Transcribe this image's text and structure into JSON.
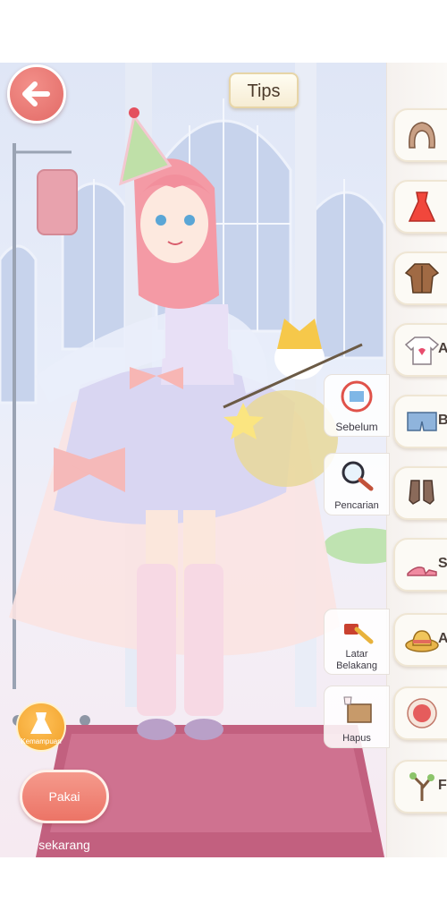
{
  "header": {
    "tips_label": "Tips"
  },
  "side_buttons": [
    {
      "label": "Sebelum",
      "icon": "shirt-undo-icon"
    },
    {
      "label": "Pencarian",
      "icon": "magnifier-icon"
    },
    {
      "label": "Latar Belakang",
      "icon": "paintbrush-icon"
    },
    {
      "label": "Hapus",
      "icon": "box-remove-icon"
    }
  ],
  "categories": [
    {
      "label": "",
      "icon": "hair-icon"
    },
    {
      "label": "",
      "icon": "dress-icon"
    },
    {
      "label": "",
      "icon": "coat-icon"
    },
    {
      "label": "A",
      "icon": "tshirt-icon"
    },
    {
      "label": "Bo",
      "icon": "shorts-icon"
    },
    {
      "label": "",
      "icon": "socks-icon"
    },
    {
      "label": "S",
      "icon": "shoes-icon"
    },
    {
      "label": "A",
      "icon": "hat-icon"
    },
    {
      "label": "",
      "icon": "makeup-icon"
    },
    {
      "label": "F",
      "icon": "branch-icon"
    }
  ],
  "bottom": {
    "ability_label": "Kemampuan",
    "wear_now_label": "Pakai sekarang"
  },
  "colors": {
    "accent": "#e66c67",
    "panel": "#fcfaf5",
    "carpet": "#c2607f"
  }
}
